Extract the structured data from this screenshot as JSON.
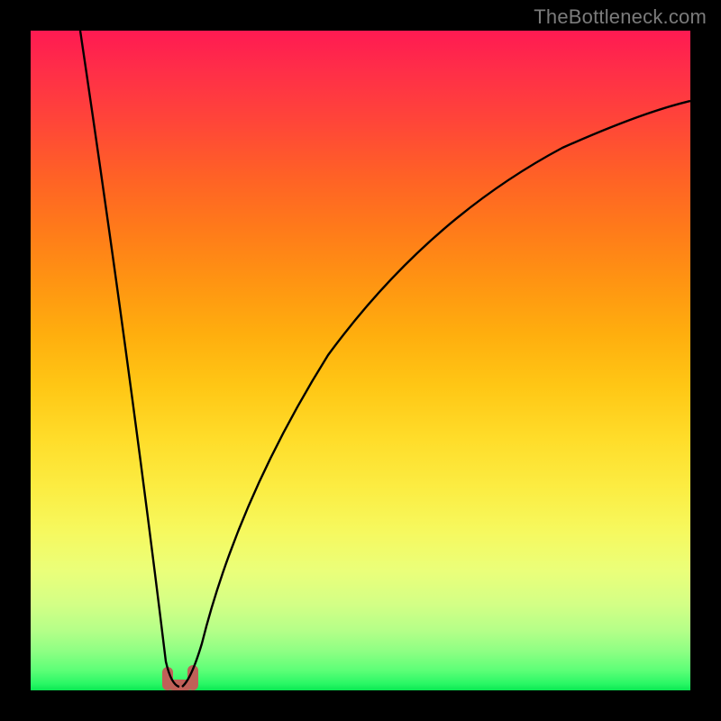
{
  "watermark": "TheBottleneck.com",
  "chart_data": {
    "type": "line",
    "title": "",
    "xlabel": "",
    "ylabel": "",
    "xlim": [
      0,
      100
    ],
    "ylim": [
      0,
      100
    ],
    "grid": false,
    "legend": false,
    "series": [
      {
        "name": "left-arm",
        "x": [
          7.5,
          10,
          12.5,
          15,
          17.5,
          20,
          21,
          22
        ],
        "values": [
          100,
          82,
          64,
          46,
          28,
          10,
          4,
          1
        ]
      },
      {
        "name": "right-arm",
        "x": [
          25,
          26,
          28,
          30,
          34,
          40,
          48,
          58,
          70,
          84,
          100
        ],
        "values": [
          1,
          6,
          14,
          22,
          34,
          48,
          60,
          70,
          78,
          84,
          89
        ]
      },
      {
        "name": "valley-marker",
        "x": [
          21,
          22,
          23,
          24,
          25
        ],
        "values": [
          4,
          1,
          0,
          1,
          4
        ]
      }
    ],
    "background_gradient": {
      "top": "#ff1a52",
      "mid": "#ffdd2a",
      "bottom": "#0be852"
    },
    "marker_color": "#c06058",
    "curve_color": "#000000"
  }
}
